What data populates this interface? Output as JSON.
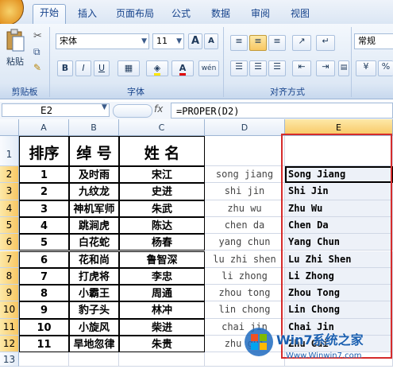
{
  "ribbon": {
    "tabs": [
      "开始",
      "插入",
      "页面布局",
      "公式",
      "数据",
      "审阅",
      "视图"
    ],
    "active_tab": "开始",
    "clipboard": {
      "paste_label": "粘贴",
      "group_label": "剪贴板"
    },
    "font": {
      "name": "宋体",
      "size": "11",
      "grow": "A",
      "shrink": "A",
      "bold": "B",
      "italic": "I",
      "underline": "U",
      "group_label": "字体",
      "phonetic": "wén"
    },
    "alignment": {
      "group_label": "对齐方式"
    },
    "number": {
      "format": "常规",
      "percent": "%"
    }
  },
  "formula_bar": {
    "cell_ref": "E2",
    "fx": "fx",
    "formula": "=PROPER(D2)"
  },
  "columns": [
    "A",
    "B",
    "C",
    "D",
    "E"
  ],
  "rows": [
    "1",
    "2",
    "3",
    "4",
    "5",
    "6",
    "7",
    "8",
    "9",
    "10",
    "11",
    "12",
    "13"
  ],
  "header": {
    "a": "排序",
    "b": "绰 号",
    "c": "姓 名"
  },
  "table": [
    {
      "n": "1",
      "nick": "及时雨",
      "name": "宋江",
      "pinyin": "song jiang",
      "proper": "Song Jiang"
    },
    {
      "n": "2",
      "nick": "九纹龙",
      "name": "史进",
      "pinyin": "shi jin",
      "proper": "Shi Jin"
    },
    {
      "n": "3",
      "nick": "神机军师",
      "name": "朱武",
      "pinyin": "zhu wu",
      "proper": "Zhu Wu"
    },
    {
      "n": "4",
      "nick": "跳涧虎",
      "name": "陈达",
      "pinyin": "chen da",
      "proper": "Chen Da"
    },
    {
      "n": "5",
      "nick": "白花蛇",
      "name": "杨春",
      "pinyin": "yang chun",
      "proper": "Yang Chun"
    },
    {
      "n": "6",
      "nick": "花和尚",
      "name": "鲁智深",
      "pinyin": "lu zhi shen",
      "proper": "Lu Zhi Shen"
    },
    {
      "n": "7",
      "nick": "打虎将",
      "name": "李忠",
      "pinyin": "li zhong",
      "proper": "Li Zhong"
    },
    {
      "n": "8",
      "nick": "小霸王",
      "name": "周通",
      "pinyin": "zhou tong",
      "proper": "Zhou Tong"
    },
    {
      "n": "9",
      "nick": "豹子头",
      "name": "林冲",
      "pinyin": "lin chong",
      "proper": "Lin Chong"
    },
    {
      "n": "10",
      "nick": "小旋风",
      "name": "柴进",
      "pinyin": "chai jin",
      "proper": "Chai Jin"
    },
    {
      "n": "11",
      "nick": "旱地忽律",
      "name": "朱贵",
      "pinyin": "zhu gui",
      "proper": "Zhu Gui"
    }
  ],
  "watermark": {
    "brand": "Win7系统之家",
    "url": "Www.Winwin7.com"
  },
  "colors": {
    "accent": "#15428b",
    "selection": "#f8c763",
    "highlight_box": "#d52b2b"
  }
}
